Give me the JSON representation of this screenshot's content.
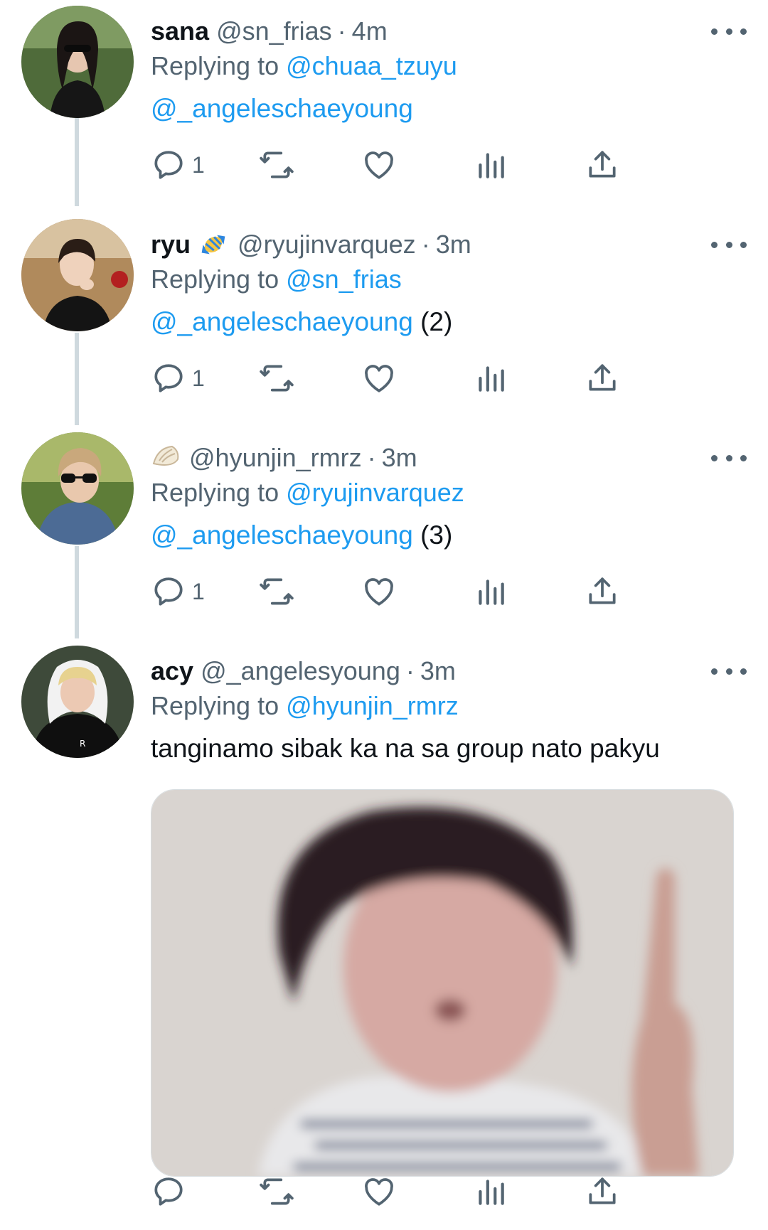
{
  "colors": {
    "link": "#1d9bf0",
    "text": "#0f1419",
    "secondary": "#536471",
    "thread_line": "#cfd9de"
  },
  "tweets": [
    {
      "name": "sana",
      "handle": "@sn_frias",
      "time": "4m",
      "replying_prefix": "Replying to",
      "replying_to": "@chuaa_tzuyu",
      "mention": "@_angeleschaeyoung",
      "text": "",
      "reply_count": "1"
    },
    {
      "name": "ryu",
      "emoji": "candy-emoji",
      "handle": "@ryujinvarquez",
      "time": "3m",
      "replying_prefix": "Replying to",
      "replying_to": "@sn_frias",
      "mention": "@_angeleschaeyoung",
      "text": "(2)",
      "reply_count": "1"
    },
    {
      "name": "",
      "emoji": "dumpling-emoji",
      "handle": "@hyunjin_rmrz",
      "time": "3m",
      "replying_prefix": "Replying to",
      "replying_to": "@ryujinvarquez",
      "mention": "@_angeleschaeyoung",
      "text": "(3)",
      "reply_count": "1"
    },
    {
      "name": "acy",
      "handle": "@_angelesyoung",
      "time": "3m",
      "replying_prefix": "Replying to",
      "replying_to": "@hyunjin_rmrz",
      "text": "tanginamo sibak ka na sa group nato pakyu",
      "has_media": true,
      "reply_count": ""
    }
  ],
  "separator": "·",
  "icons": [
    "reply-icon",
    "retweet-icon",
    "like-icon",
    "analytics-icon",
    "share-icon",
    "more-icon"
  ]
}
